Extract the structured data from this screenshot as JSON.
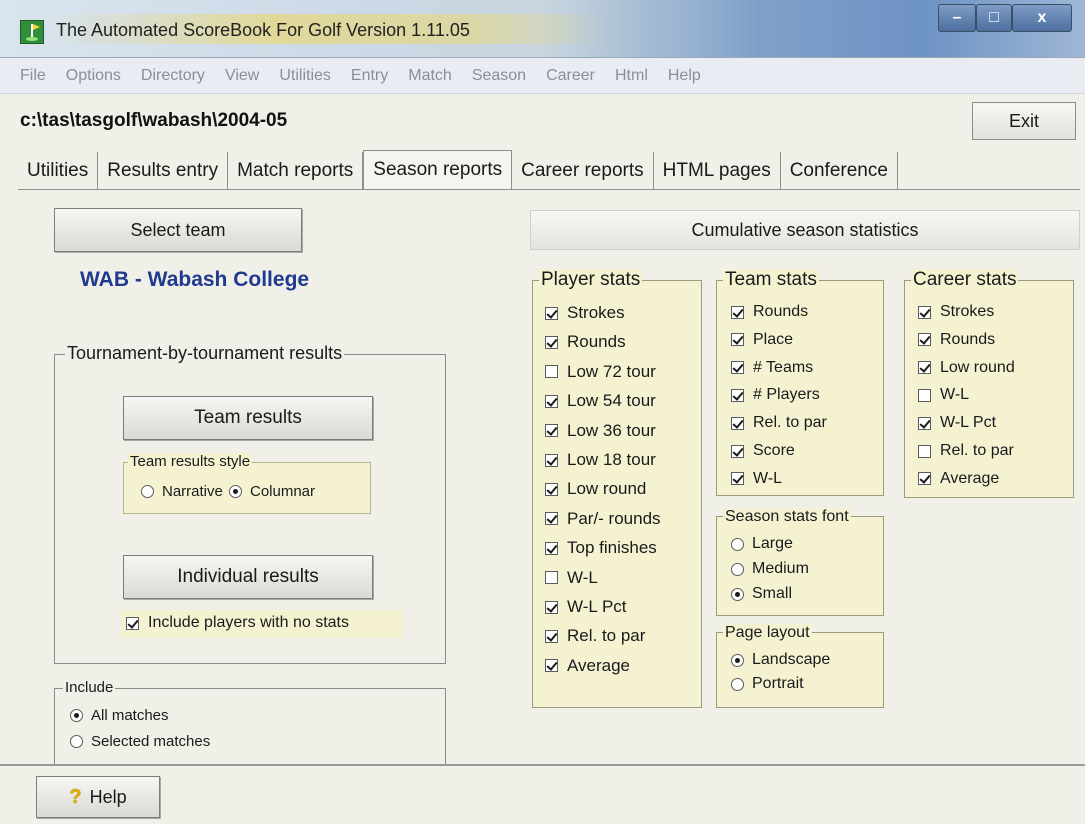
{
  "window": {
    "title": "The Automated ScoreBook For Golf  Version 1.11.05",
    "controls": {
      "minimize": "–",
      "maximize": "□",
      "close": "x"
    }
  },
  "menu": [
    "File",
    "Options",
    "Directory",
    "View",
    "Utilities",
    "Entry",
    "Match",
    "Season",
    "Career",
    "Html",
    "Help"
  ],
  "path": "c:\\tas\\tasgolf\\wabash\\2004-05",
  "exit_label": "Exit",
  "tabs": [
    "Utilities",
    "Results entry",
    "Match reports",
    "Season reports",
    "Career reports",
    "HTML pages",
    "Conference"
  ],
  "active_tab": "Season reports",
  "left": {
    "select_team": "Select team",
    "team_name": "WAB - Wabash College",
    "tournament_group": "Tournament-by-tournament results",
    "team_results": "Team results",
    "team_results_style": {
      "label": "Team results style",
      "options": [
        {
          "label": "Narrative",
          "selected": false
        },
        {
          "label": "Columnar",
          "selected": true
        }
      ]
    },
    "individual_results": "Individual results",
    "include_no_stats": {
      "label": "Include players with no stats",
      "checked": true
    },
    "include": {
      "label": "Include",
      "options": [
        {
          "label": "All matches",
          "selected": true
        },
        {
          "label": "Selected matches",
          "selected": false
        }
      ]
    }
  },
  "right": {
    "cumulative": "Cumulative season statistics",
    "player_stats": {
      "label": "Player stats",
      "items": [
        {
          "label": "Strokes",
          "checked": true
        },
        {
          "label": "Rounds",
          "checked": true
        },
        {
          "label": "Low 72 tour",
          "checked": false
        },
        {
          "label": "Low 54 tour",
          "checked": true
        },
        {
          "label": "Low 36 tour",
          "checked": true
        },
        {
          "label": "Low 18 tour",
          "checked": true
        },
        {
          "label": "Low round",
          "checked": true
        },
        {
          "label": "Par/- rounds",
          "checked": true
        },
        {
          "label": "Top finishes",
          "checked": true
        },
        {
          "label": "W-L",
          "checked": false
        },
        {
          "label": "W-L Pct",
          "checked": true
        },
        {
          "label": "Rel. to par",
          "checked": true
        },
        {
          "label": "Average",
          "checked": true
        }
      ]
    },
    "team_stats": {
      "label": "Team stats",
      "items": [
        {
          "label": "Rounds",
          "checked": true
        },
        {
          "label": "Place",
          "checked": true
        },
        {
          "label": "# Teams",
          "checked": true
        },
        {
          "label": "# Players",
          "checked": true
        },
        {
          "label": "Rel. to par",
          "checked": true
        },
        {
          "label": "Score",
          "checked": true
        },
        {
          "label": "W-L",
          "checked": true
        }
      ]
    },
    "season_font": {
      "label": "Season stats font",
      "options": [
        {
          "label": "Large",
          "selected": false
        },
        {
          "label": "Medium",
          "selected": false
        },
        {
          "label": "Small",
          "selected": true
        }
      ]
    },
    "page_layout": {
      "label": "Page layout",
      "options": [
        {
          "label": "Landscape",
          "selected": true
        },
        {
          "label": "Portrait",
          "selected": false
        }
      ]
    },
    "career_stats": {
      "label": "Career stats",
      "items": [
        {
          "label": "Strokes",
          "checked": true
        },
        {
          "label": "Rounds",
          "checked": true
        },
        {
          "label": "Low round",
          "checked": true
        },
        {
          "label": "W-L",
          "checked": false
        },
        {
          "label": "W-L Pct",
          "checked": true
        },
        {
          "label": "Rel. to par",
          "checked": false
        },
        {
          "label": "Average",
          "checked": true
        }
      ]
    }
  },
  "help_label": "Help"
}
